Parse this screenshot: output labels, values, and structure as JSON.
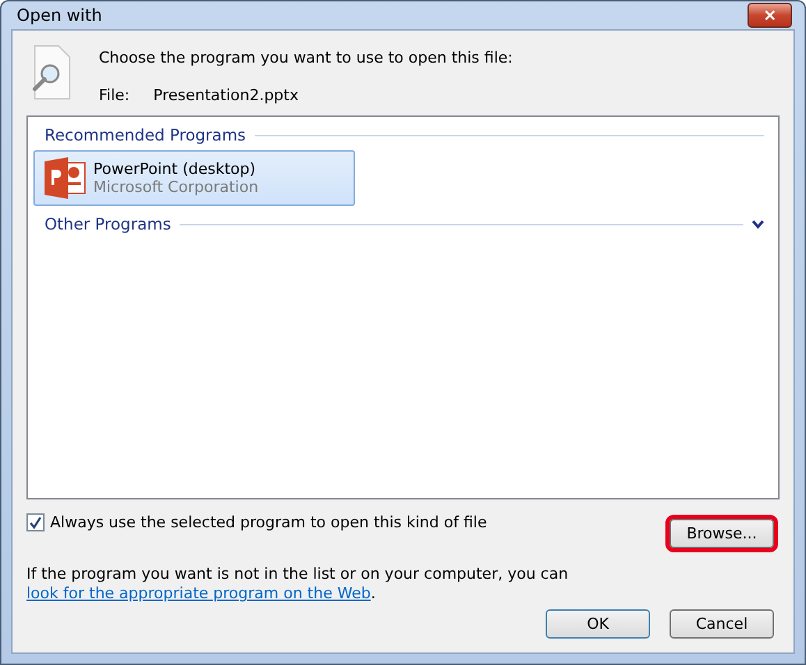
{
  "window": {
    "title": "Open with",
    "close": "✕"
  },
  "prompt": "Choose the program you want to use to open this file:",
  "file": {
    "label": "File:",
    "name": "Presentation2.pptx"
  },
  "groups": [
    {
      "title": "Recommended Programs",
      "expanded": true,
      "programs": [
        {
          "name": "PowerPoint (desktop)",
          "publisher": "Microsoft Corporation",
          "selected": true
        }
      ]
    },
    {
      "title": "Other Programs",
      "expanded": false
    }
  ],
  "always_use": {
    "label": "Always use the selected program to open this kind of file",
    "checked": true
  },
  "browse": {
    "label": "Browse...",
    "highlighted": true
  },
  "hint": {
    "text": "If the program you want is not in the list or on your computer, you can ",
    "link": "look for the appropriate program on the Web",
    "end": "."
  },
  "buttons": [
    {
      "label": "OK",
      "default": true
    },
    {
      "label": "Cancel",
      "default": false
    }
  ]
}
